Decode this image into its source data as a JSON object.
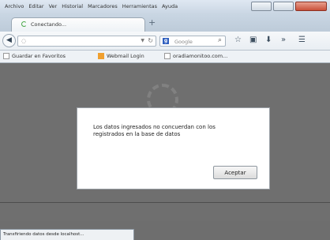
{
  "menubar": {
    "items": [
      "Archivo",
      "Editar",
      "Ver",
      "Historial",
      "Marcadores",
      "Herramientas",
      "Ayuda"
    ]
  },
  "tab": {
    "title": "Conectando..."
  },
  "nav": {
    "search_placeholder": "Google"
  },
  "bookmarks": {
    "items": [
      {
        "label": "Guardar en Favoritos"
      },
      {
        "label": "Webmail Login"
      },
      {
        "label": "oradiamonitoo.com..."
      }
    ]
  },
  "dialog": {
    "message": "Los datos ingresados no concuerdan con los registrados en la base de datos",
    "ok_label": "Aceptar"
  },
  "status": {
    "text": "Transfiriendo datos desde localhost..."
  },
  "colors": {
    "dialog_bg": "#ffffff",
    "page_bg": "#6e6e6e",
    "close_button": "#c9503a",
    "bookmark_icon": "#f0a030"
  }
}
